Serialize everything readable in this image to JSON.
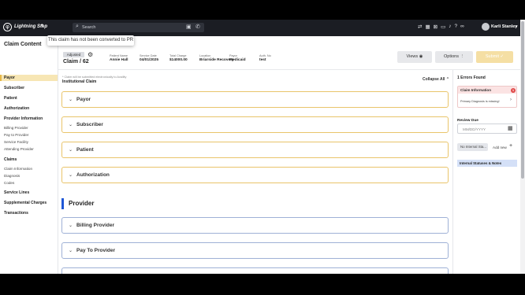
{
  "topbar": {
    "logo_glyph": "φ",
    "brand": "Lightning Step",
    "search_placeholder": "Search",
    "user_name": "Karli Stanley",
    "icons": [
      "filter-icon",
      "calendar-icon",
      "inbox-icon",
      "chat-icon",
      "bell-icon",
      "help-icon",
      "link-icon"
    ]
  },
  "tooltip": "This claim has not been converted to PR",
  "sidebar": {
    "title": "Claim Content",
    "items": [
      {
        "label": "Payor",
        "kind": "sec",
        "active": true
      },
      {
        "label": "Subscriber",
        "kind": "sec"
      },
      {
        "label": "Patient",
        "kind": "sec"
      },
      {
        "label": "Authorization",
        "kind": "sec"
      },
      {
        "label": "Provider Information",
        "kind": "sec"
      },
      {
        "label": "Billing Provider",
        "kind": "sub"
      },
      {
        "label": "Pay to Provider",
        "kind": "sub"
      },
      {
        "label": "Service Facility",
        "kind": "sub"
      },
      {
        "label": "Attending Provider",
        "kind": "sub"
      },
      {
        "label": "Claims",
        "kind": "sec"
      },
      {
        "label": "Claim Information",
        "kind": "sub"
      },
      {
        "label": "Diagnosis",
        "kind": "sub"
      },
      {
        "label": "Codes",
        "kind": "sub"
      },
      {
        "label": "Service Lines",
        "kind": "sec"
      },
      {
        "label": "Supplemental Charges",
        "kind": "sec"
      },
      {
        "label": "Transactions",
        "kind": "sec"
      }
    ]
  },
  "claim": {
    "status": "Adjusted",
    "id": "Claim / 62",
    "fields": [
      {
        "label": "Patient Name",
        "value": "Annie Hall"
      },
      {
        "label": "Service Date",
        "value": "04/01/2025"
      },
      {
        "label": "Total Charge",
        "value": "$14000.00"
      },
      {
        "label": "Location",
        "value": "Briarside Recovery"
      },
      {
        "label": "Payor",
        "value": "Medicaid"
      },
      {
        "label": "Auth. No",
        "value": "test"
      }
    ]
  },
  "actions": {
    "views": "Views",
    "options": "Options",
    "submit": "Submit"
  },
  "main": {
    "note": "* Claim will be submitted electronically to Availity",
    "claim_type": "Institutional Claim",
    "collapse_all": "Collapse All",
    "sections": [
      "Payor",
      "Subscriber",
      "Patient",
      "Authorization"
    ],
    "provider_heading": "Provider",
    "provider_sections": [
      "Billing Provider",
      "Pay To Provider"
    ]
  },
  "right_panel": {
    "errors_found": "1 Errors Found",
    "error_category": "Claim Information",
    "error_count": "1",
    "error_detail": "Primary Diagnosis is missing!",
    "review_due_label": "Review Due",
    "review_due_placeholder": "MM/DD/YYYY",
    "internal_status": "No Internal Sta...",
    "add_new": "Add new",
    "notes_header": "Internal Statuses & Notes"
  }
}
